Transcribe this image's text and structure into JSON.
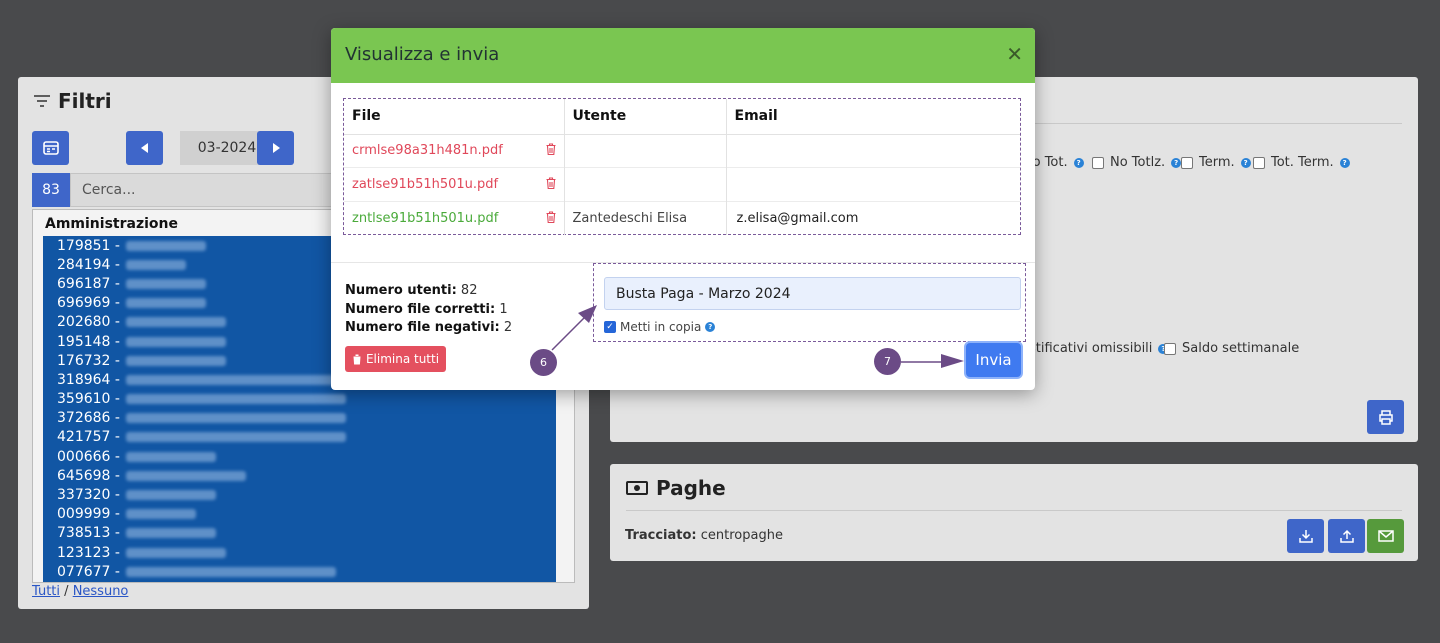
{
  "filtri": {
    "title": "Filtri",
    "month": "03-2024",
    "count": "83",
    "search_placeholder": "Cerca...",
    "list_header": "Amministrazione",
    "items": [
      "179851 -",
      "284194 -",
      "696187 -",
      "696969 -",
      "202680 -",
      "195148 -",
      "176732 -",
      "318964 -",
      "359610 -",
      "372686 -",
      "421757 -",
      "000666 -",
      "645698 -",
      "337320 -",
      "009999 -",
      "738513 -",
      "123123 -",
      "077677 -"
    ],
    "select_all": "Tutti",
    "separator": "/",
    "select_none": "Nessuno"
  },
  "right_panel": {
    "checks": [
      {
        "label": "lo Tot."
      },
      {
        "label": "No Totlz."
      },
      {
        "label": "Term."
      },
      {
        "label": "Tot. Term."
      }
    ],
    "checks2": [
      {
        "label": "stificativi omissibili"
      },
      {
        "label": "Saldo settimanale"
      }
    ]
  },
  "paghe": {
    "title": "Paghe",
    "tracciato_label": "Tracciato:",
    "tracciato_value": "centropaghe"
  },
  "modal": {
    "title": "Visualizza e invia",
    "columns": [
      "File",
      "Utente",
      "Email"
    ],
    "rows": [
      {
        "file": "crmlse98a31h481n.pdf",
        "utente": "",
        "email": "",
        "status": "error"
      },
      {
        "file": "zatlse91b51h501u.pdf",
        "utente": "",
        "email": "",
        "status": "error"
      },
      {
        "file": "zntlse91b51h501u.pdf",
        "utente": "Zantedeschi Elisa",
        "email": "z.elisa@gmail.com",
        "status": "ok"
      }
    ],
    "stats": [
      {
        "label": "Numero utenti:",
        "value": "82"
      },
      {
        "label": "Numero file corretti:",
        "value": "1"
      },
      {
        "label": "Numero file negativi:",
        "value": "2"
      }
    ],
    "delete_all": "Elimina tutti",
    "subject": "Busta Paga - Marzo 2024",
    "copy_label": "Metti in copia",
    "send": "Invia"
  },
  "annotations": {
    "marker_6": "6",
    "marker_7": "7"
  },
  "colors": {
    "header_green": "#7ac651",
    "primary_blue": "#3f66c9",
    "danger_red": "#e4505f",
    "marker_purple": "#6b4b86"
  }
}
